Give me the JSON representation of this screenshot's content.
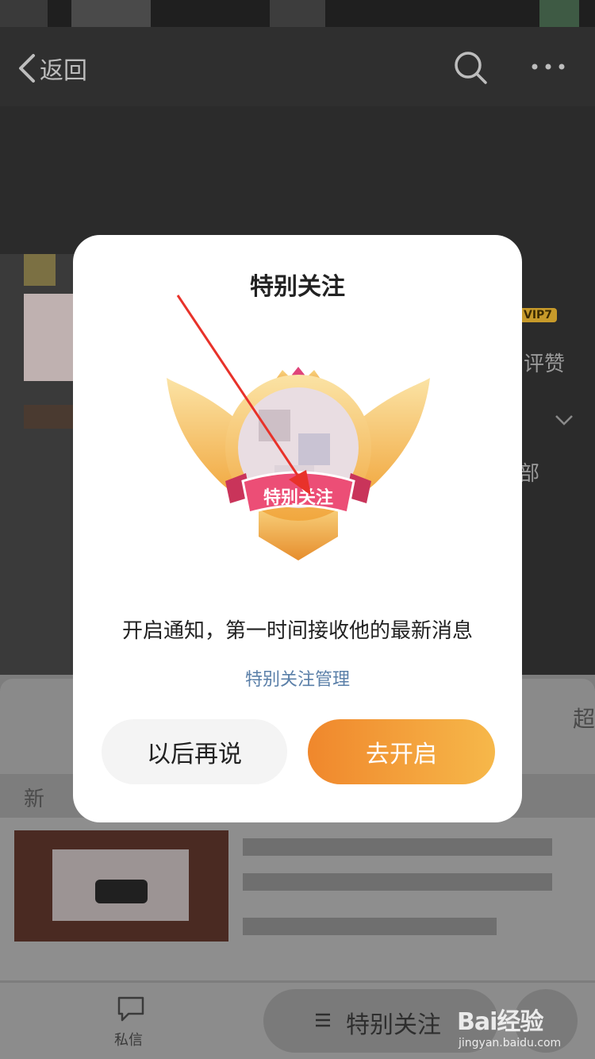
{
  "nav": {
    "back_label": "返回"
  },
  "profile": {
    "vip_badge": "VIP7",
    "side_text_1": "评赞",
    "side_text_2": "部"
  },
  "lower": {
    "tab_right_partial": "超",
    "section_partial": "新"
  },
  "tabbar": {
    "message_label": "私信",
    "special_follow_label": "特别关注"
  },
  "modal": {
    "title": "特别关注",
    "badge_ribbon_text": "特别关注",
    "description": "开启通知，第一时间接收他的最新消息",
    "manage_link": "特别关注管理",
    "later_button": "以后再说",
    "enable_button": "去开启"
  },
  "watermark": {
    "logo": "Bai经验",
    "url": "jingyan.baidu.com"
  },
  "colors": {
    "accent_orange": "#f0872c",
    "link_blue": "#5a7fa8",
    "arrow_red": "#e8322a"
  }
}
